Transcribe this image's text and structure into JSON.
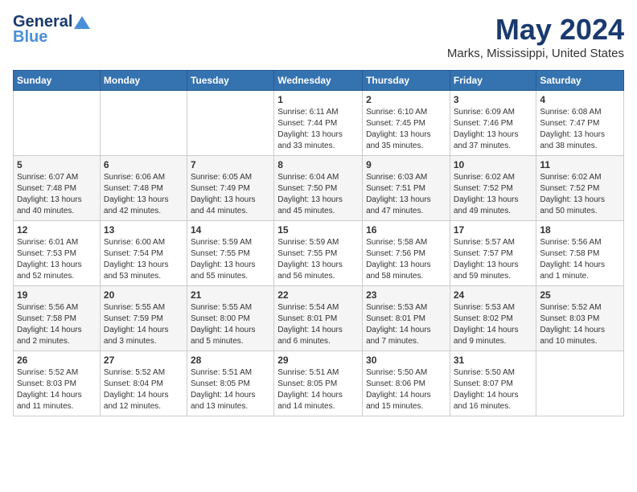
{
  "logo": {
    "general": "General",
    "blue": "Blue"
  },
  "title": "May 2024",
  "location": "Marks, Mississippi, United States",
  "headers": [
    "Sunday",
    "Monday",
    "Tuesday",
    "Wednesday",
    "Thursday",
    "Friday",
    "Saturday"
  ],
  "weeks": [
    [
      {
        "day": "",
        "info": ""
      },
      {
        "day": "",
        "info": ""
      },
      {
        "day": "",
        "info": ""
      },
      {
        "day": "1",
        "info": "Sunrise: 6:11 AM\nSunset: 7:44 PM\nDaylight: 13 hours\nand 33 minutes."
      },
      {
        "day": "2",
        "info": "Sunrise: 6:10 AM\nSunset: 7:45 PM\nDaylight: 13 hours\nand 35 minutes."
      },
      {
        "day": "3",
        "info": "Sunrise: 6:09 AM\nSunset: 7:46 PM\nDaylight: 13 hours\nand 37 minutes."
      },
      {
        "day": "4",
        "info": "Sunrise: 6:08 AM\nSunset: 7:47 PM\nDaylight: 13 hours\nand 38 minutes."
      }
    ],
    [
      {
        "day": "5",
        "info": "Sunrise: 6:07 AM\nSunset: 7:48 PM\nDaylight: 13 hours\nand 40 minutes."
      },
      {
        "day": "6",
        "info": "Sunrise: 6:06 AM\nSunset: 7:48 PM\nDaylight: 13 hours\nand 42 minutes."
      },
      {
        "day": "7",
        "info": "Sunrise: 6:05 AM\nSunset: 7:49 PM\nDaylight: 13 hours\nand 44 minutes."
      },
      {
        "day": "8",
        "info": "Sunrise: 6:04 AM\nSunset: 7:50 PM\nDaylight: 13 hours\nand 45 minutes."
      },
      {
        "day": "9",
        "info": "Sunrise: 6:03 AM\nSunset: 7:51 PM\nDaylight: 13 hours\nand 47 minutes."
      },
      {
        "day": "10",
        "info": "Sunrise: 6:02 AM\nSunset: 7:52 PM\nDaylight: 13 hours\nand 49 minutes."
      },
      {
        "day": "11",
        "info": "Sunrise: 6:02 AM\nSunset: 7:52 PM\nDaylight: 13 hours\nand 50 minutes."
      }
    ],
    [
      {
        "day": "12",
        "info": "Sunrise: 6:01 AM\nSunset: 7:53 PM\nDaylight: 13 hours\nand 52 minutes."
      },
      {
        "day": "13",
        "info": "Sunrise: 6:00 AM\nSunset: 7:54 PM\nDaylight: 13 hours\nand 53 minutes."
      },
      {
        "day": "14",
        "info": "Sunrise: 5:59 AM\nSunset: 7:55 PM\nDaylight: 13 hours\nand 55 minutes."
      },
      {
        "day": "15",
        "info": "Sunrise: 5:59 AM\nSunset: 7:55 PM\nDaylight: 13 hours\nand 56 minutes."
      },
      {
        "day": "16",
        "info": "Sunrise: 5:58 AM\nSunset: 7:56 PM\nDaylight: 13 hours\nand 58 minutes."
      },
      {
        "day": "17",
        "info": "Sunrise: 5:57 AM\nSunset: 7:57 PM\nDaylight: 13 hours\nand 59 minutes."
      },
      {
        "day": "18",
        "info": "Sunrise: 5:56 AM\nSunset: 7:58 PM\nDaylight: 14 hours\nand 1 minute."
      }
    ],
    [
      {
        "day": "19",
        "info": "Sunrise: 5:56 AM\nSunset: 7:58 PM\nDaylight: 14 hours\nand 2 minutes."
      },
      {
        "day": "20",
        "info": "Sunrise: 5:55 AM\nSunset: 7:59 PM\nDaylight: 14 hours\nand 3 minutes."
      },
      {
        "day": "21",
        "info": "Sunrise: 5:55 AM\nSunset: 8:00 PM\nDaylight: 14 hours\nand 5 minutes."
      },
      {
        "day": "22",
        "info": "Sunrise: 5:54 AM\nSunset: 8:01 PM\nDaylight: 14 hours\nand 6 minutes."
      },
      {
        "day": "23",
        "info": "Sunrise: 5:53 AM\nSunset: 8:01 PM\nDaylight: 14 hours\nand 7 minutes."
      },
      {
        "day": "24",
        "info": "Sunrise: 5:53 AM\nSunset: 8:02 PM\nDaylight: 14 hours\nand 9 minutes."
      },
      {
        "day": "25",
        "info": "Sunrise: 5:52 AM\nSunset: 8:03 PM\nDaylight: 14 hours\nand 10 minutes."
      }
    ],
    [
      {
        "day": "26",
        "info": "Sunrise: 5:52 AM\nSunset: 8:03 PM\nDaylight: 14 hours\nand 11 minutes."
      },
      {
        "day": "27",
        "info": "Sunrise: 5:52 AM\nSunset: 8:04 PM\nDaylight: 14 hours\nand 12 minutes."
      },
      {
        "day": "28",
        "info": "Sunrise: 5:51 AM\nSunset: 8:05 PM\nDaylight: 14 hours\nand 13 minutes."
      },
      {
        "day": "29",
        "info": "Sunrise: 5:51 AM\nSunset: 8:05 PM\nDaylight: 14 hours\nand 14 minutes."
      },
      {
        "day": "30",
        "info": "Sunrise: 5:50 AM\nSunset: 8:06 PM\nDaylight: 14 hours\nand 15 minutes."
      },
      {
        "day": "31",
        "info": "Sunrise: 5:50 AM\nSunset: 8:07 PM\nDaylight: 14 hours\nand 16 minutes."
      },
      {
        "day": "",
        "info": ""
      }
    ]
  ]
}
